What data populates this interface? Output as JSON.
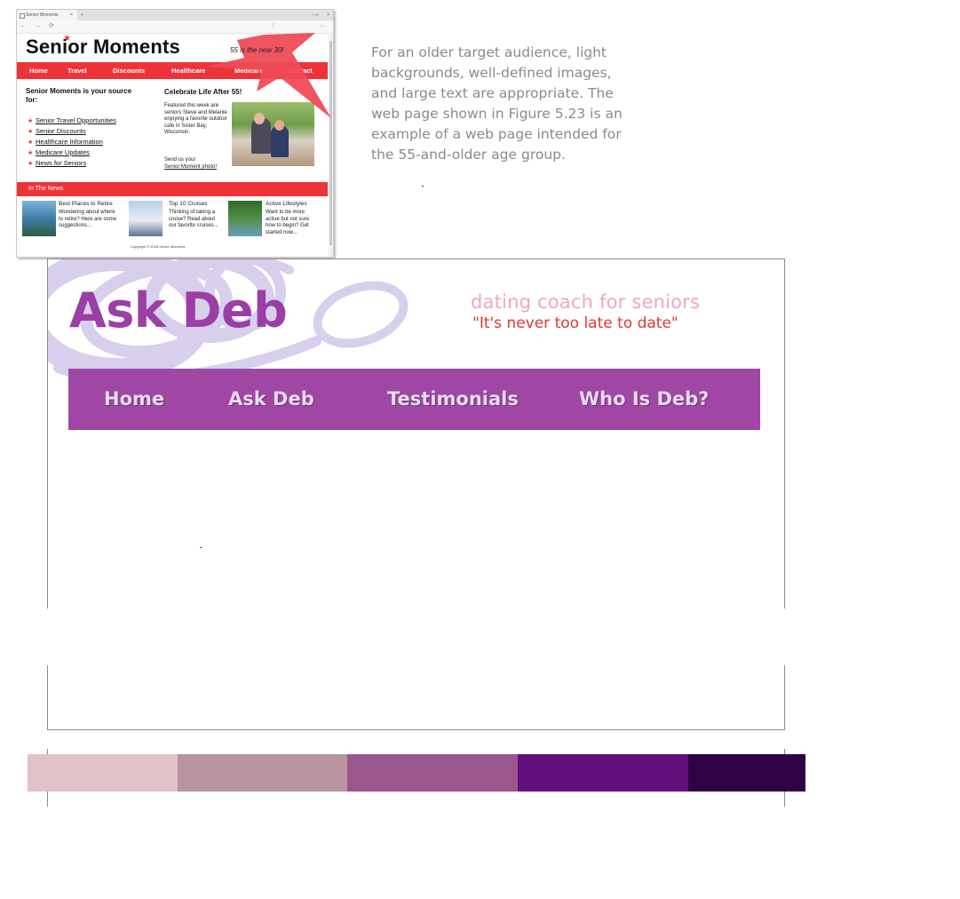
{
  "thumbnail": {
    "tab_title": "Senior Moments",
    "tab_close": "×",
    "tab_plus": "+",
    "window_controls": "▫  ▭",
    "window_close": "×",
    "nav_back": "←",
    "nav_forward": "→",
    "nav_refresh": "⟳",
    "nav_more": "···",
    "site_title": "Senior Moments",
    "tagline": "55 is the new 30!",
    "nav_items": [
      "Home",
      "Travel",
      "Discounts",
      "Healthcare",
      "Medicare",
      "Contact"
    ],
    "source_heading": "Senior Moments is your source for:",
    "source_list": [
      "Senior Travel Opportunities",
      "Senior Discounts",
      "Healthcare Information",
      "Medicare Updates",
      "News for Seniors"
    ],
    "celebrate_heading": "Celebrate Life After 55!",
    "featured_text": "Featured this week are seniors Steve and Melanie enjoying a favorite outdoor cafe in Sister Bay, Wisconsin.",
    "send_text": "Send us your",
    "send_link": "Senior Moment photo!",
    "news_heading": "In The News",
    "news": [
      {
        "title": "Best Places to Retire",
        "body": "Wondering about where to retire? Here are some suggestions..."
      },
      {
        "title": "Top 10 Cruises",
        "body": "Thinking of taking a cruise? Read about our favorite cruises..."
      },
      {
        "title": "Active Lifestyles",
        "body": "Want to be more active but not sure how to begin? Get started now..."
      }
    ],
    "copyright": "Copyright © 2018 Senior Moments",
    "accent_color": "#ee3338"
  },
  "intro_text": "For an older target audience, light backgrounds, well-defined images, and large text are appropriate. The web page shown in Figure 5.23 is an example of a web page intended for the 55-and-older age group.",
  "askdeb": {
    "title": "Ask Deb",
    "tagline": "dating coach for seniors",
    "quote": "\"It's never too late to date\"",
    "nav_items": [
      "Home",
      "Ask Deb",
      "Testimonials",
      "Who Is Deb?"
    ],
    "title_color": "#9b3ea5",
    "nav_color": "#a047a6"
  },
  "palette": [
    "#e2c2c9",
    "#b9949f",
    "#9a568d",
    "#620f7d",
    "#310145"
  ]
}
